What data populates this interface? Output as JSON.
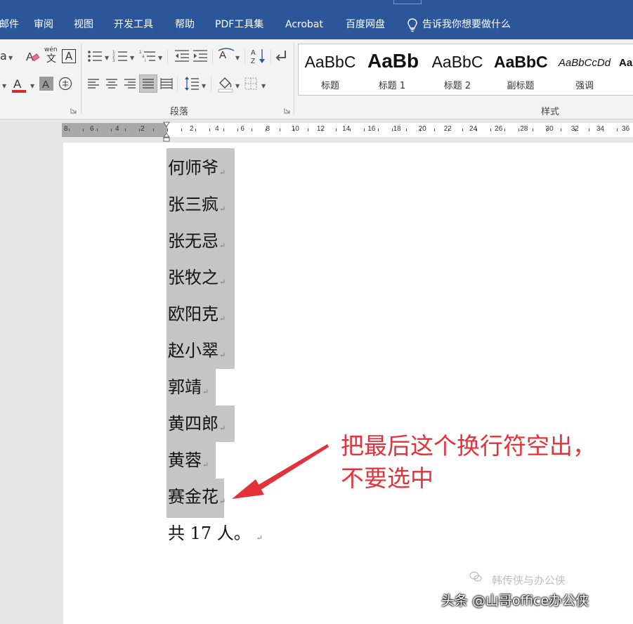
{
  "menu": {
    "items": [
      "邮件",
      "审阅",
      "视图",
      "开发工具",
      "帮助",
      "PDF工具集",
      "Acrobat",
      "百度网盘"
    ],
    "tell_me": "告诉我你想要做什么"
  },
  "ribbon": {
    "paragraph_label": "段落",
    "styles_label": "样式",
    "wen_top": "wén",
    "wen_bottom": "文",
    "boxed_A": "A",
    "font_a": "a",
    "styles": [
      {
        "sample": "AaBbC",
        "name": "标题"
      },
      {
        "sample": "AaBb",
        "name": "标题 1"
      },
      {
        "sample": "AaBbC",
        "name": "标题 2"
      },
      {
        "sample": "AaBbC",
        "name": "副标题"
      },
      {
        "sample": "AaBbCcDd",
        "name": "强调"
      },
      {
        "sample": "Aa",
        "name": ""
      }
    ]
  },
  "ruler": {
    "left_numbers": [
      "8",
      "6",
      "4",
      "2"
    ],
    "right_numbers": [
      "2",
      "4",
      "6",
      "8",
      "10",
      "12",
      "14",
      "16",
      "18",
      "20",
      "22",
      "24",
      "26",
      "28",
      "30",
      "32",
      "34",
      "36"
    ]
  },
  "document": {
    "lines": [
      "何师爷",
      "张三疯",
      "张无忌",
      "张牧之",
      "欧阳克",
      "赵小翠",
      "郭靖",
      "黄四郎",
      "黄蓉",
      "赛金花"
    ],
    "total_line": "共 17 人。",
    "para_mark": "↵"
  },
  "annotation": {
    "line1": "把最后这个换行符空出，",
    "line2": "不要选中"
  },
  "watermark": {
    "text": "头条 @山哥office办公侠",
    "faint_text": "韩传侠与办公侠"
  },
  "colors": {
    "menu_blue": "#2b579a",
    "selection_gray": "#c5c5c5",
    "annotation_red": "#e5323a",
    "font_color_red": "#d22d2d"
  }
}
